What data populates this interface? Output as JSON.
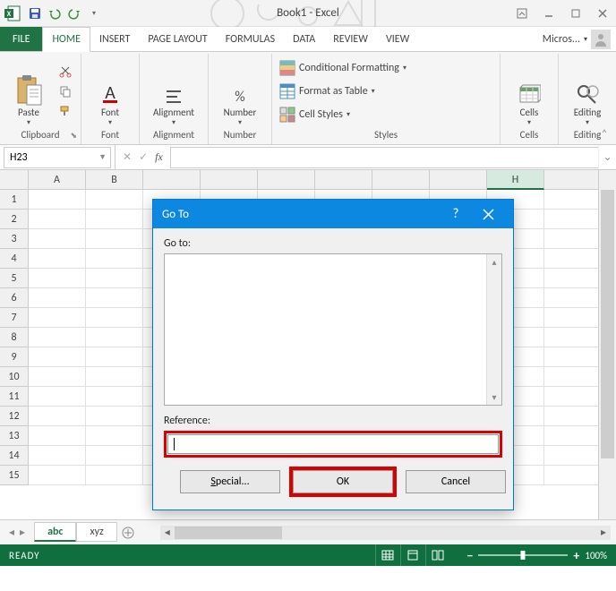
{
  "app": {
    "title": "Book1 - Excel"
  },
  "ribbon": {
    "tabs": [
      "FILE",
      "HOME",
      "INSERT",
      "PAGE LAYOUT",
      "FORMULAS",
      "DATA",
      "REVIEW",
      "VIEW"
    ],
    "user_label": "Micros...",
    "groups": {
      "clipboard": {
        "label": "Clipboard",
        "paste": "Paste"
      },
      "font": {
        "label": "Font",
        "btn": "Font"
      },
      "alignment": {
        "label": "Alignment",
        "btn": "Alignment"
      },
      "number": {
        "label": "Number",
        "btn": "Number"
      },
      "styles": {
        "label": "Styles",
        "conditional": "Conditional Formatting",
        "table": "Format as Table",
        "cellstyles": "Cell Styles"
      },
      "cells": {
        "label": "Cells",
        "btn": "Cells"
      },
      "editing": {
        "label": "Editing",
        "btn": "Editing"
      }
    }
  },
  "formula_bar": {
    "name_box": "H23",
    "formula": ""
  },
  "grid": {
    "columns": [
      "A",
      "B",
      "",
      "",
      "",
      "",
      "",
      "",
      "H",
      ""
    ],
    "rows": [
      "1",
      "2",
      "3",
      "4",
      "5",
      "6",
      "7",
      "8",
      "9",
      "10",
      "11",
      "12",
      "13",
      "14",
      "15"
    ],
    "selected_col": "H"
  },
  "sheets": {
    "tabs": [
      "abc",
      "xyz"
    ],
    "active": "abc"
  },
  "statusbar": {
    "state": "READY",
    "zoom": "100%"
  },
  "dialog": {
    "title": "Go To",
    "help": "?",
    "goto_label": "Go to:",
    "ref_label": "Reference:",
    "ref_value": "",
    "buttons": {
      "special": "Special...",
      "ok": "OK",
      "cancel": "Cancel"
    }
  }
}
